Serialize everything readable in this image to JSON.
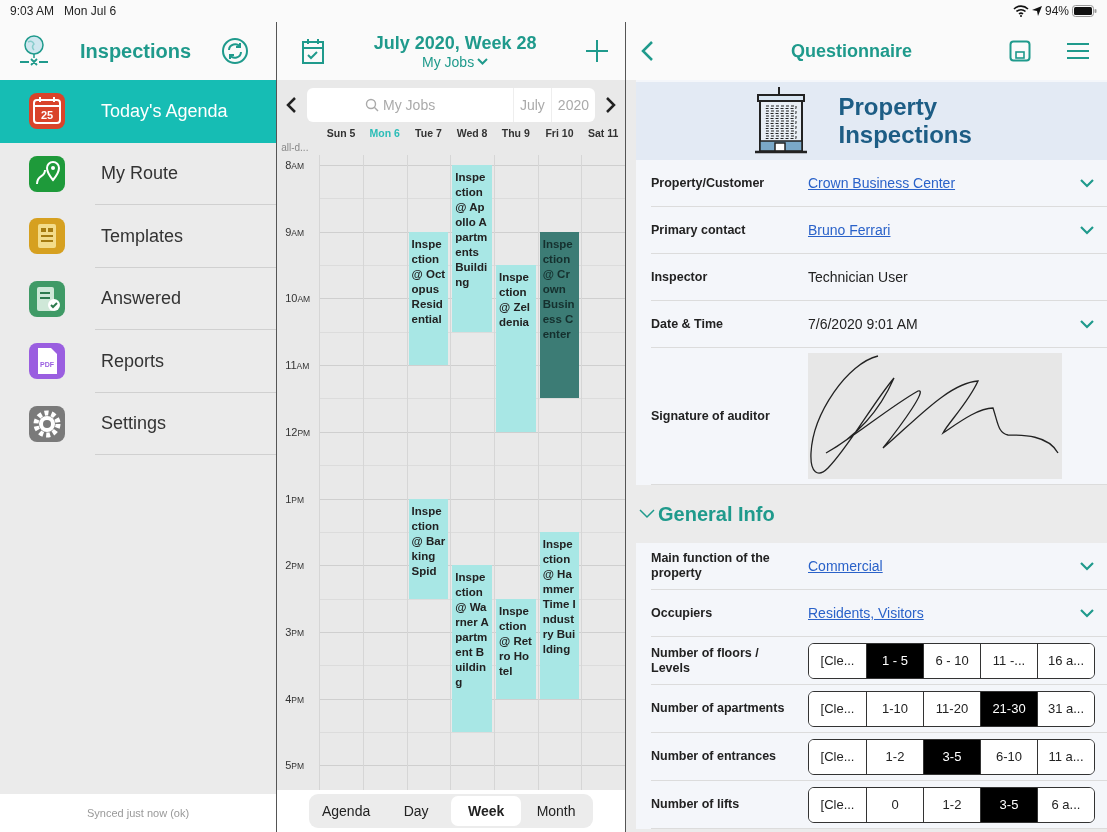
{
  "status_bar": {
    "time": "9:03 AM",
    "date": "Mon Jul 6",
    "battery": "94%"
  },
  "sidebar": {
    "title": "Inspections",
    "items": [
      {
        "label": "Today's Agenda",
        "kind": "calendar",
        "icon_text": "25",
        "color": "#d9432a",
        "selected": true
      },
      {
        "label": "My Route",
        "kind": "route",
        "color": "#1e9a3a",
        "selected": false
      },
      {
        "label": "Templates",
        "kind": "template",
        "color": "#d6a020",
        "selected": false
      },
      {
        "label": "Answered",
        "kind": "answered",
        "color": "#3f9a66",
        "selected": false
      },
      {
        "label": "Reports",
        "kind": "pdf",
        "icon_text": "PDF",
        "color": "#9a5ee0",
        "selected": false
      },
      {
        "label": "Settings",
        "kind": "gear",
        "color": "#7a7a7a",
        "selected": false
      }
    ],
    "sync_status": "Synced just now (ok)"
  },
  "calendar": {
    "title": "July 2020, Week 28",
    "filter": "My Jobs",
    "search": {
      "placeholder": "My Jobs"
    },
    "month": "July",
    "year": "2020",
    "days": [
      {
        "label": "Sun 5",
        "selected": false
      },
      {
        "label": "Mon 6",
        "selected": true
      },
      {
        "label": "Tue 7",
        "selected": false
      },
      {
        "label": "Wed 8",
        "selected": false
      },
      {
        "label": "Thu 9",
        "selected": false
      },
      {
        "label": "Fri 10",
        "selected": false
      },
      {
        "label": "Sat 11",
        "selected": false
      }
    ],
    "all_day_label": "all-d...",
    "hours": [
      {
        "hour": "8",
        "period": "AM"
      },
      {
        "hour": "9",
        "period": "AM"
      },
      {
        "hour": "10",
        "period": "AM"
      },
      {
        "hour": "11",
        "period": "AM"
      },
      {
        "hour": "12",
        "period": "PM"
      },
      {
        "hour": "1",
        "period": "PM"
      },
      {
        "hour": "2",
        "period": "PM"
      },
      {
        "hour": "3",
        "period": "PM"
      },
      {
        "hour": "4",
        "period": "PM"
      },
      {
        "hour": "5",
        "period": "PM"
      }
    ],
    "events": [
      {
        "title": "Inspection @ Octopus Residential",
        "selected": false
      },
      {
        "title": "Inspection @ Apollo Apartments Building",
        "selected": false
      },
      {
        "title": "Inspection @ Zeldenia",
        "selected": false
      },
      {
        "title": "Inspection @ Crown Business Center",
        "selected": true
      },
      {
        "title": "Inspection @ Barking Spid",
        "selected": false
      },
      {
        "title": "Inspection @ Warner Apartment Building",
        "selected": false
      },
      {
        "title": "Inspection @ Retro Hotel",
        "selected": false
      },
      {
        "title": "Inspection @ Hammer Time Industry Building",
        "selected": false
      }
    ],
    "views": [
      {
        "label": "Agenda",
        "selected": false
      },
      {
        "label": "Day",
        "selected": false
      },
      {
        "label": "Week",
        "selected": true
      },
      {
        "label": "Month",
        "selected": false
      }
    ]
  },
  "questionnaire": {
    "title": "Questionnaire",
    "banner_title": "Property Inspections",
    "fields": [
      {
        "kind": "link",
        "label": "Property/Customer",
        "value": "Crown Business Center",
        "dropdown": true
      },
      {
        "kind": "link",
        "label": "Primary contact",
        "value": "Bruno Ferrari",
        "dropdown": true
      },
      {
        "kind": "text",
        "label": "Inspector",
        "value": "Technician User",
        "dropdown": false
      },
      {
        "kind": "text",
        "label": "Date & Time",
        "value": "7/6/2020 9:01 AM",
        "dropdown": true
      },
      {
        "kind": "signature",
        "label": "Signature of auditor"
      }
    ],
    "section": {
      "title": "General Info",
      "expanded": true,
      "fields": [
        {
          "kind": "link",
          "label": "Main function of the property",
          "value": "Commercial",
          "dropdown": true
        },
        {
          "kind": "link",
          "label": "Occupiers",
          "value": "Residents, Visitors",
          "dropdown": true
        },
        {
          "kind": "choice",
          "label": "Number of floors / Levels",
          "options": [
            {
              "label": "[Cle...",
              "selected": false
            },
            {
              "label": "1 - 5",
              "selected": true
            },
            {
              "label": "6 - 10",
              "selected": false
            },
            {
              "label": "11 -...",
              "selected": false
            },
            {
              "label": "16 a...",
              "selected": false
            }
          ]
        },
        {
          "kind": "choice",
          "label": "Number of apartments",
          "options": [
            {
              "label": "[Cle...",
              "selected": false
            },
            {
              "label": "1-10",
              "selected": false
            },
            {
              "label": "11-20",
              "selected": false
            },
            {
              "label": "21-30",
              "selected": true
            },
            {
              "label": "31 a...",
              "selected": false
            }
          ]
        },
        {
          "kind": "choice",
          "label": "Number of entrances",
          "options": [
            {
              "label": "[Cle...",
              "selected": false
            },
            {
              "label": "1-2",
              "selected": false
            },
            {
              "label": "3-5",
              "selected": true
            },
            {
              "label": "6-10",
              "selected": false
            },
            {
              "label": "11 a...",
              "selected": false
            }
          ]
        },
        {
          "kind": "choice",
          "label": "Number of lifts",
          "options": [
            {
              "label": "[Cle...",
              "selected": false
            },
            {
              "label": "0",
              "selected": false
            },
            {
              "label": "1-2",
              "selected": false
            },
            {
              "label": "3-5",
              "selected": true
            },
            {
              "label": "6 a...",
              "selected": false
            }
          ]
        }
      ]
    }
  }
}
